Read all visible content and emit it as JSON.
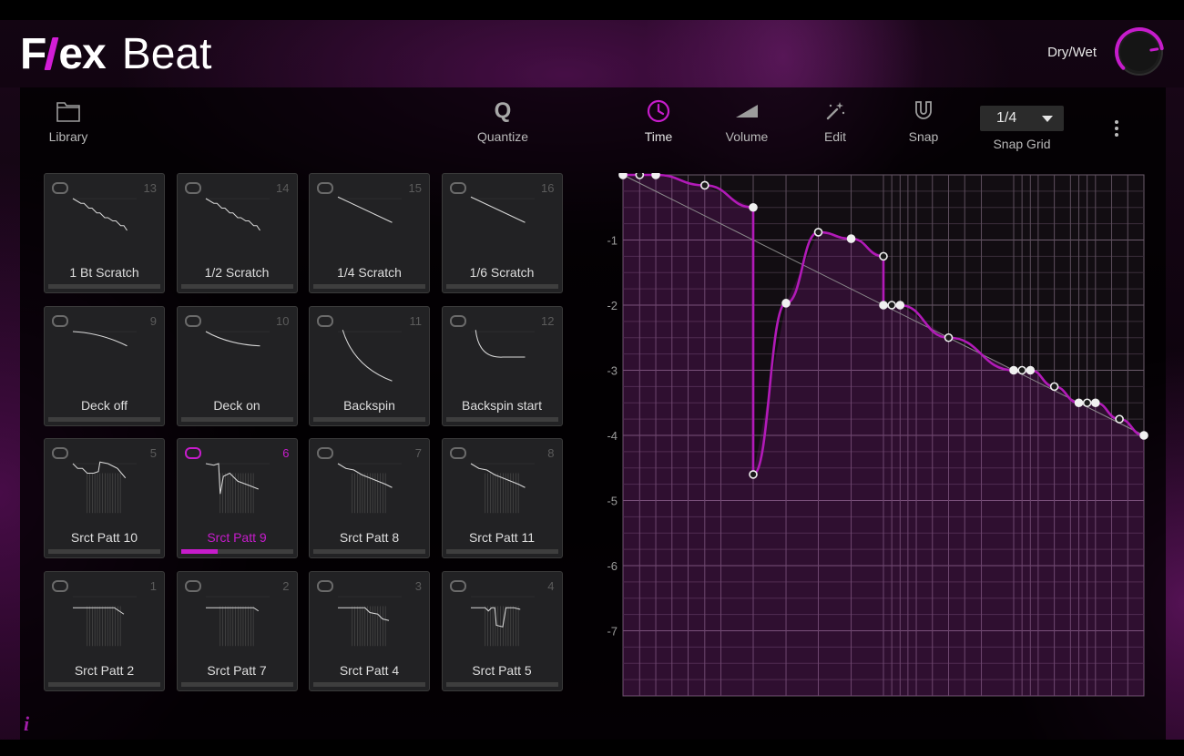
{
  "app": {
    "title_bold_left": "F",
    "title_bold_right": "ex",
    "title_thin": "Beat",
    "drywet_label": "Dry/Wet",
    "drywet_value": 0.8,
    "info_label": "i"
  },
  "colors": {
    "accent": "#c61ccb",
    "pad_bg": "#222224",
    "text": "#dedede",
    "muted": "#5b5b5b"
  },
  "toolbar": {
    "library": {
      "label": "Library",
      "icon": "folder-icon"
    },
    "quantize": {
      "label": "Quantize",
      "glyph": "Q",
      "icon": "quantize-icon"
    },
    "time": {
      "label": "Time",
      "icon": "clock-icon",
      "active": true
    },
    "volume": {
      "label": "Volume",
      "icon": "volume-ramp-icon"
    },
    "edit": {
      "label": "Edit",
      "icon": "magic-wand-icon"
    },
    "snap": {
      "label": "Snap",
      "icon": "magnet-icon"
    },
    "snapgrid": {
      "label": "Snap Grid",
      "value": "1/4",
      "icon": "chevron-down-icon"
    },
    "more_icon": "more-vertical-icon"
  },
  "pads": [
    {
      "name": "1 Bt Scratch",
      "num": "13",
      "selected": false,
      "progress": 0,
      "wave": "steps"
    },
    {
      "name": "1/2 Scratch",
      "num": "14",
      "selected": false,
      "progress": 0,
      "wave": "steps"
    },
    {
      "name": "1/4 Scratch",
      "num": "15",
      "selected": false,
      "progress": 0,
      "wave": "line"
    },
    {
      "name": "1/6 Scratch",
      "num": "16",
      "selected": false,
      "progress": 0,
      "wave": "line"
    },
    {
      "name": "Deck off",
      "num": "9",
      "selected": false,
      "progress": 0,
      "wave": "curve_down"
    },
    {
      "name": "Deck on",
      "num": "10",
      "selected": false,
      "progress": 0,
      "wave": "curve_soft"
    },
    {
      "name": "Backspin",
      "num": "11",
      "selected": false,
      "progress": 0,
      "wave": "exp_decay"
    },
    {
      "name": "Backspin start",
      "num": "12",
      "selected": false,
      "progress": 0,
      "wave": "exp_flat"
    },
    {
      "name": "Srct Patt 10",
      "num": "5",
      "selected": false,
      "progress": 0,
      "wave": "patt_a"
    },
    {
      "name": "Srct Patt 9",
      "num": "6",
      "selected": true,
      "progress": 0.33,
      "wave": "patt_b"
    },
    {
      "name": "Srct Patt 8",
      "num": "7",
      "selected": false,
      "progress": 0,
      "wave": "patt_c"
    },
    {
      "name": "Srct Patt 11",
      "num": "8",
      "selected": false,
      "progress": 0,
      "wave": "patt_c"
    },
    {
      "name": "Srct Patt 2",
      "num": "1",
      "selected": false,
      "progress": 0,
      "wave": "patt_d"
    },
    {
      "name": "Srct Patt 7",
      "num": "2",
      "selected": false,
      "progress": 0,
      "wave": "patt_e"
    },
    {
      "name": "Srct Patt 4",
      "num": "3",
      "selected": false,
      "progress": 0,
      "wave": "patt_f"
    },
    {
      "name": "Srct Patt 5",
      "num": "4",
      "selected": false,
      "progress": 0,
      "wave": "patt_g"
    }
  ],
  "chart_data": {
    "type": "line",
    "y_ticks": [
      "-1",
      "-2",
      "-3",
      "-4",
      "-5",
      "-6",
      "-7"
    ],
    "xlim": [
      0,
      1
    ],
    "ylim": [
      -8,
      0
    ],
    "grid": true,
    "reference_line": {
      "x": [
        0,
        1
      ],
      "y": [
        0,
        -4
      ]
    },
    "points": [
      {
        "x": 0.0,
        "y": 0.0
      },
      {
        "x": 0.032,
        "y": 0.0
      },
      {
        "x": 0.063,
        "y": 0.0
      },
      {
        "x": 0.157,
        "y": -0.16
      },
      {
        "x": 0.25,
        "y": -0.5
      },
      {
        "x": 0.25,
        "y": -4.6
      },
      {
        "x": 0.313,
        "y": -1.97
      },
      {
        "x": 0.375,
        "y": -0.88
      },
      {
        "x": 0.438,
        "y": -0.98
      },
      {
        "x": 0.5,
        "y": -1.25
      },
      {
        "x": 0.5,
        "y": -2.0
      },
      {
        "x": 0.516,
        "y": -2.0
      },
      {
        "x": 0.532,
        "y": -2.0
      },
      {
        "x": 0.625,
        "y": -2.5
      },
      {
        "x": 0.75,
        "y": -3.0
      },
      {
        "x": 0.766,
        "y": -3.0
      },
      {
        "x": 0.782,
        "y": -3.0
      },
      {
        "x": 0.828,
        "y": -3.25
      },
      {
        "x": 0.875,
        "y": -3.5
      },
      {
        "x": 0.891,
        "y": -3.5
      },
      {
        "x": 0.907,
        "y": -3.5
      },
      {
        "x": 0.953,
        "y": -3.75
      },
      {
        "x": 1.0,
        "y": -4.0
      }
    ],
    "vertical_grid_x": [
      0.032,
      0.063,
      0.094,
      0.125,
      0.157,
      0.188,
      0.25,
      0.313,
      0.375,
      0.438,
      0.5,
      0.516,
      0.532,
      0.547,
      0.563,
      0.594,
      0.625,
      0.656,
      0.688,
      0.75,
      0.766,
      0.782,
      0.797,
      0.828,
      0.859,
      0.875,
      0.891,
      0.907,
      0.938,
      0.969
    ]
  }
}
